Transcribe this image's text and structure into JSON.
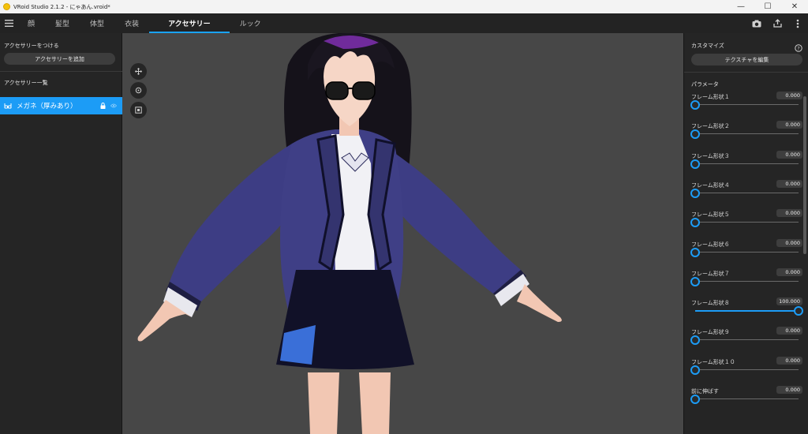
{
  "window": {
    "title": "VRoid Studio 2.1.2 - にゃあん.vroid*",
    "minimize": "—",
    "maximize": "☐",
    "close": "✕"
  },
  "nav": {
    "tabs": [
      {
        "label": "顔"
      },
      {
        "label": "髪型"
      },
      {
        "label": "体型"
      },
      {
        "label": "衣装"
      },
      {
        "label": "アクセサリー",
        "active": true
      },
      {
        "label": "ルック"
      }
    ]
  },
  "left": {
    "attach_title": "アクセサリーをつける",
    "add_button": "アクセサリーを追加",
    "list_title": "アクセサリー一覧",
    "items": [
      {
        "label": "メガネ（厚みあり）",
        "selected": true
      }
    ]
  },
  "right": {
    "customize_title": "カスタマイズ",
    "edit_texture_button": "テクスチャを編集",
    "params_title": "パラメータ",
    "params": [
      {
        "label": "フレーム形状１",
        "value": "0.000",
        "level": 0
      },
      {
        "label": "フレーム形状２",
        "value": "0.000",
        "level": 0
      },
      {
        "label": "フレーム形状３",
        "value": "0.000",
        "level": 0
      },
      {
        "label": "フレーム形状４",
        "value": "0.000",
        "level": 0
      },
      {
        "label": "フレーム形状５",
        "value": "0.000",
        "level": 0
      },
      {
        "label": "フレーム形状６",
        "value": "0.000",
        "level": 0
      },
      {
        "label": "フレーム形状７",
        "value": "0.000",
        "level": 0
      },
      {
        "label": "フレーム形状８",
        "value": "100.000",
        "level": 1
      },
      {
        "label": "フレーム形状９",
        "value": "0.000",
        "level": 0
      },
      {
        "label": "フレーム形状１０",
        "value": "0.000",
        "level": 0
      },
      {
        "label": "前に伸ばす",
        "value": "0.000",
        "level": 0
      }
    ]
  },
  "colors": {
    "accent": "#1c9cf6",
    "panel": "#252525",
    "viewport": "#474747"
  }
}
